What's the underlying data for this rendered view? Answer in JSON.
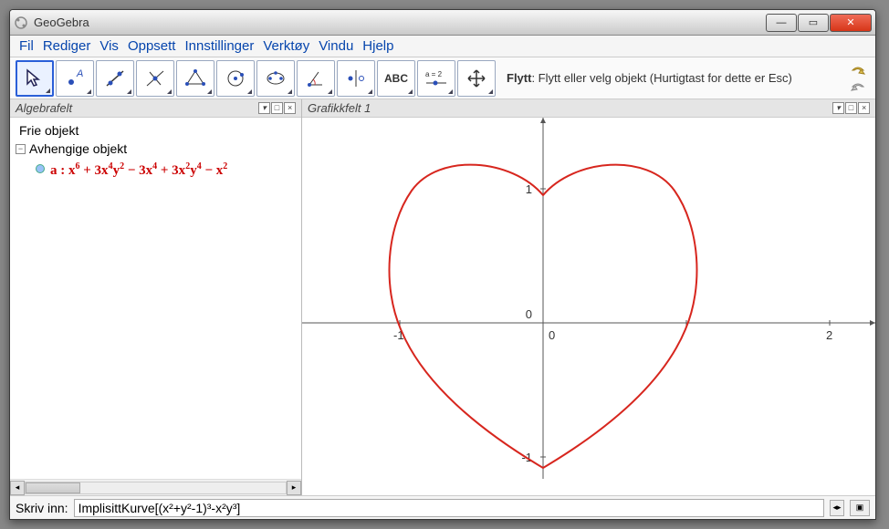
{
  "window": {
    "title": "GeoGebra"
  },
  "menu": {
    "items": [
      "Fil",
      "Rediger",
      "Vis",
      "Oppsett",
      "Innstillinger",
      "Verktøy",
      "Vindu",
      "Hjelp"
    ]
  },
  "tool_hint": {
    "name": "Flytt",
    "desc": ": Flytt eller velg objekt (Hurtigtast for dette er Esc)"
  },
  "algebra": {
    "title": "Algebrafelt",
    "free_label": "Frie objekt",
    "dep_label": "Avhengige objekt",
    "objects": [
      {
        "name": "a",
        "expr_html": "a : x<sup>6</sup> + 3x<sup>4</sup>y<sup>2</sup> − 3x<sup>4</sup> + 3x<sup>2</sup>y<sup>4</sup> − x<sup>2</sup>"
      }
    ]
  },
  "graphics": {
    "title": "Grafikkfelt 1",
    "axis": {
      "x_ticks": [
        {
          "v": -1,
          "label": "-1"
        },
        {
          "v": 0,
          "label": "0"
        },
        {
          "v": 2,
          "label": "2"
        }
      ],
      "y_ticks": [
        {
          "v": 1,
          "label": "1"
        },
        {
          "v": 0,
          "label": "0"
        },
        {
          "v": -1,
          "label": "-1"
        }
      ],
      "x_range": [
        -1.5,
        2.5
      ],
      "y_range": [
        -1.3,
        1.4
      ]
    },
    "curve": {
      "name": "a",
      "color": "#d7261e",
      "equation": "ImplisittKurve[(x²+y²-1)³-x²y³]"
    }
  },
  "input": {
    "label": "Skriv inn:",
    "value": "ImplisittKurve[(x²+y²-1)³-x²y³]"
  }
}
